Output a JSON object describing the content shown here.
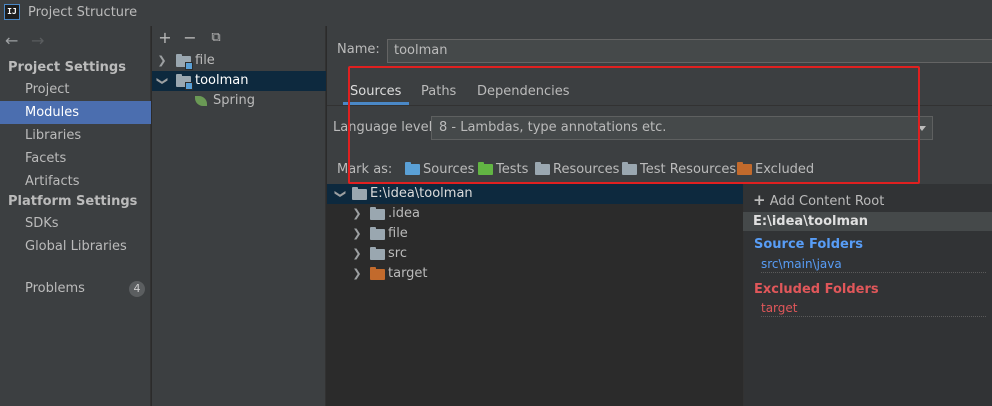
{
  "window": {
    "title": "Project Structure",
    "app_icon": "IJ"
  },
  "nav": {
    "back_icon": "←",
    "forward_icon": "→",
    "project_settings_header": "Project Settings",
    "project_items": [
      "Project",
      "Modules",
      "Libraries",
      "Facets",
      "Artifacts"
    ],
    "selected_item": "Modules",
    "platform_settings_header": "Platform Settings",
    "platform_items": [
      "SDKs",
      "Global Libraries"
    ],
    "problems_label": "Problems",
    "problems_count": "4"
  },
  "module_toolbar": {
    "add": "+",
    "remove": "−",
    "copy": "⧉"
  },
  "modules": {
    "items": [
      {
        "label": "file",
        "expanded": false
      },
      {
        "label": "toolman",
        "expanded": true,
        "selected": true
      },
      {
        "label": "Spring",
        "child": true
      }
    ]
  },
  "editor": {
    "name_label": "Name:",
    "name_value": "toolman",
    "tabs": [
      "Sources",
      "Paths",
      "Dependencies"
    ],
    "active_tab": "Sources",
    "language_level_label": "Language level:",
    "language_level_value": "8 - Lambdas, type annotations etc.",
    "mark_as_label": "Mark as:",
    "mark_as_options": [
      {
        "label": "Sources",
        "color": "#5aa0d6"
      },
      {
        "label": "Tests",
        "color": "#62b543"
      },
      {
        "label": "Resources",
        "color": "#9aa7b0"
      },
      {
        "label": "Test Resources",
        "color": "#9aa7b0"
      },
      {
        "label": "Excluded",
        "color": "#c26a2c"
      }
    ]
  },
  "content_tree": {
    "root": "E:\\idea\\toolman",
    "children": [
      {
        "label": ".idea",
        "color": "grey"
      },
      {
        "label": "file",
        "color": "grey"
      },
      {
        "label": "src",
        "color": "grey"
      },
      {
        "label": "target",
        "color": "orange"
      }
    ]
  },
  "content_roots": {
    "add_label": "Add Content Root",
    "root_path": "E:\\idea\\toolman",
    "source_folders_title": "Source Folders",
    "source_folders": [
      "src\\main\\java"
    ],
    "excluded_folders_title": "Excluded Folders",
    "excluded_folders": [
      "target"
    ],
    "source_color": "#589df6",
    "excluded_color": "#e0575a"
  }
}
